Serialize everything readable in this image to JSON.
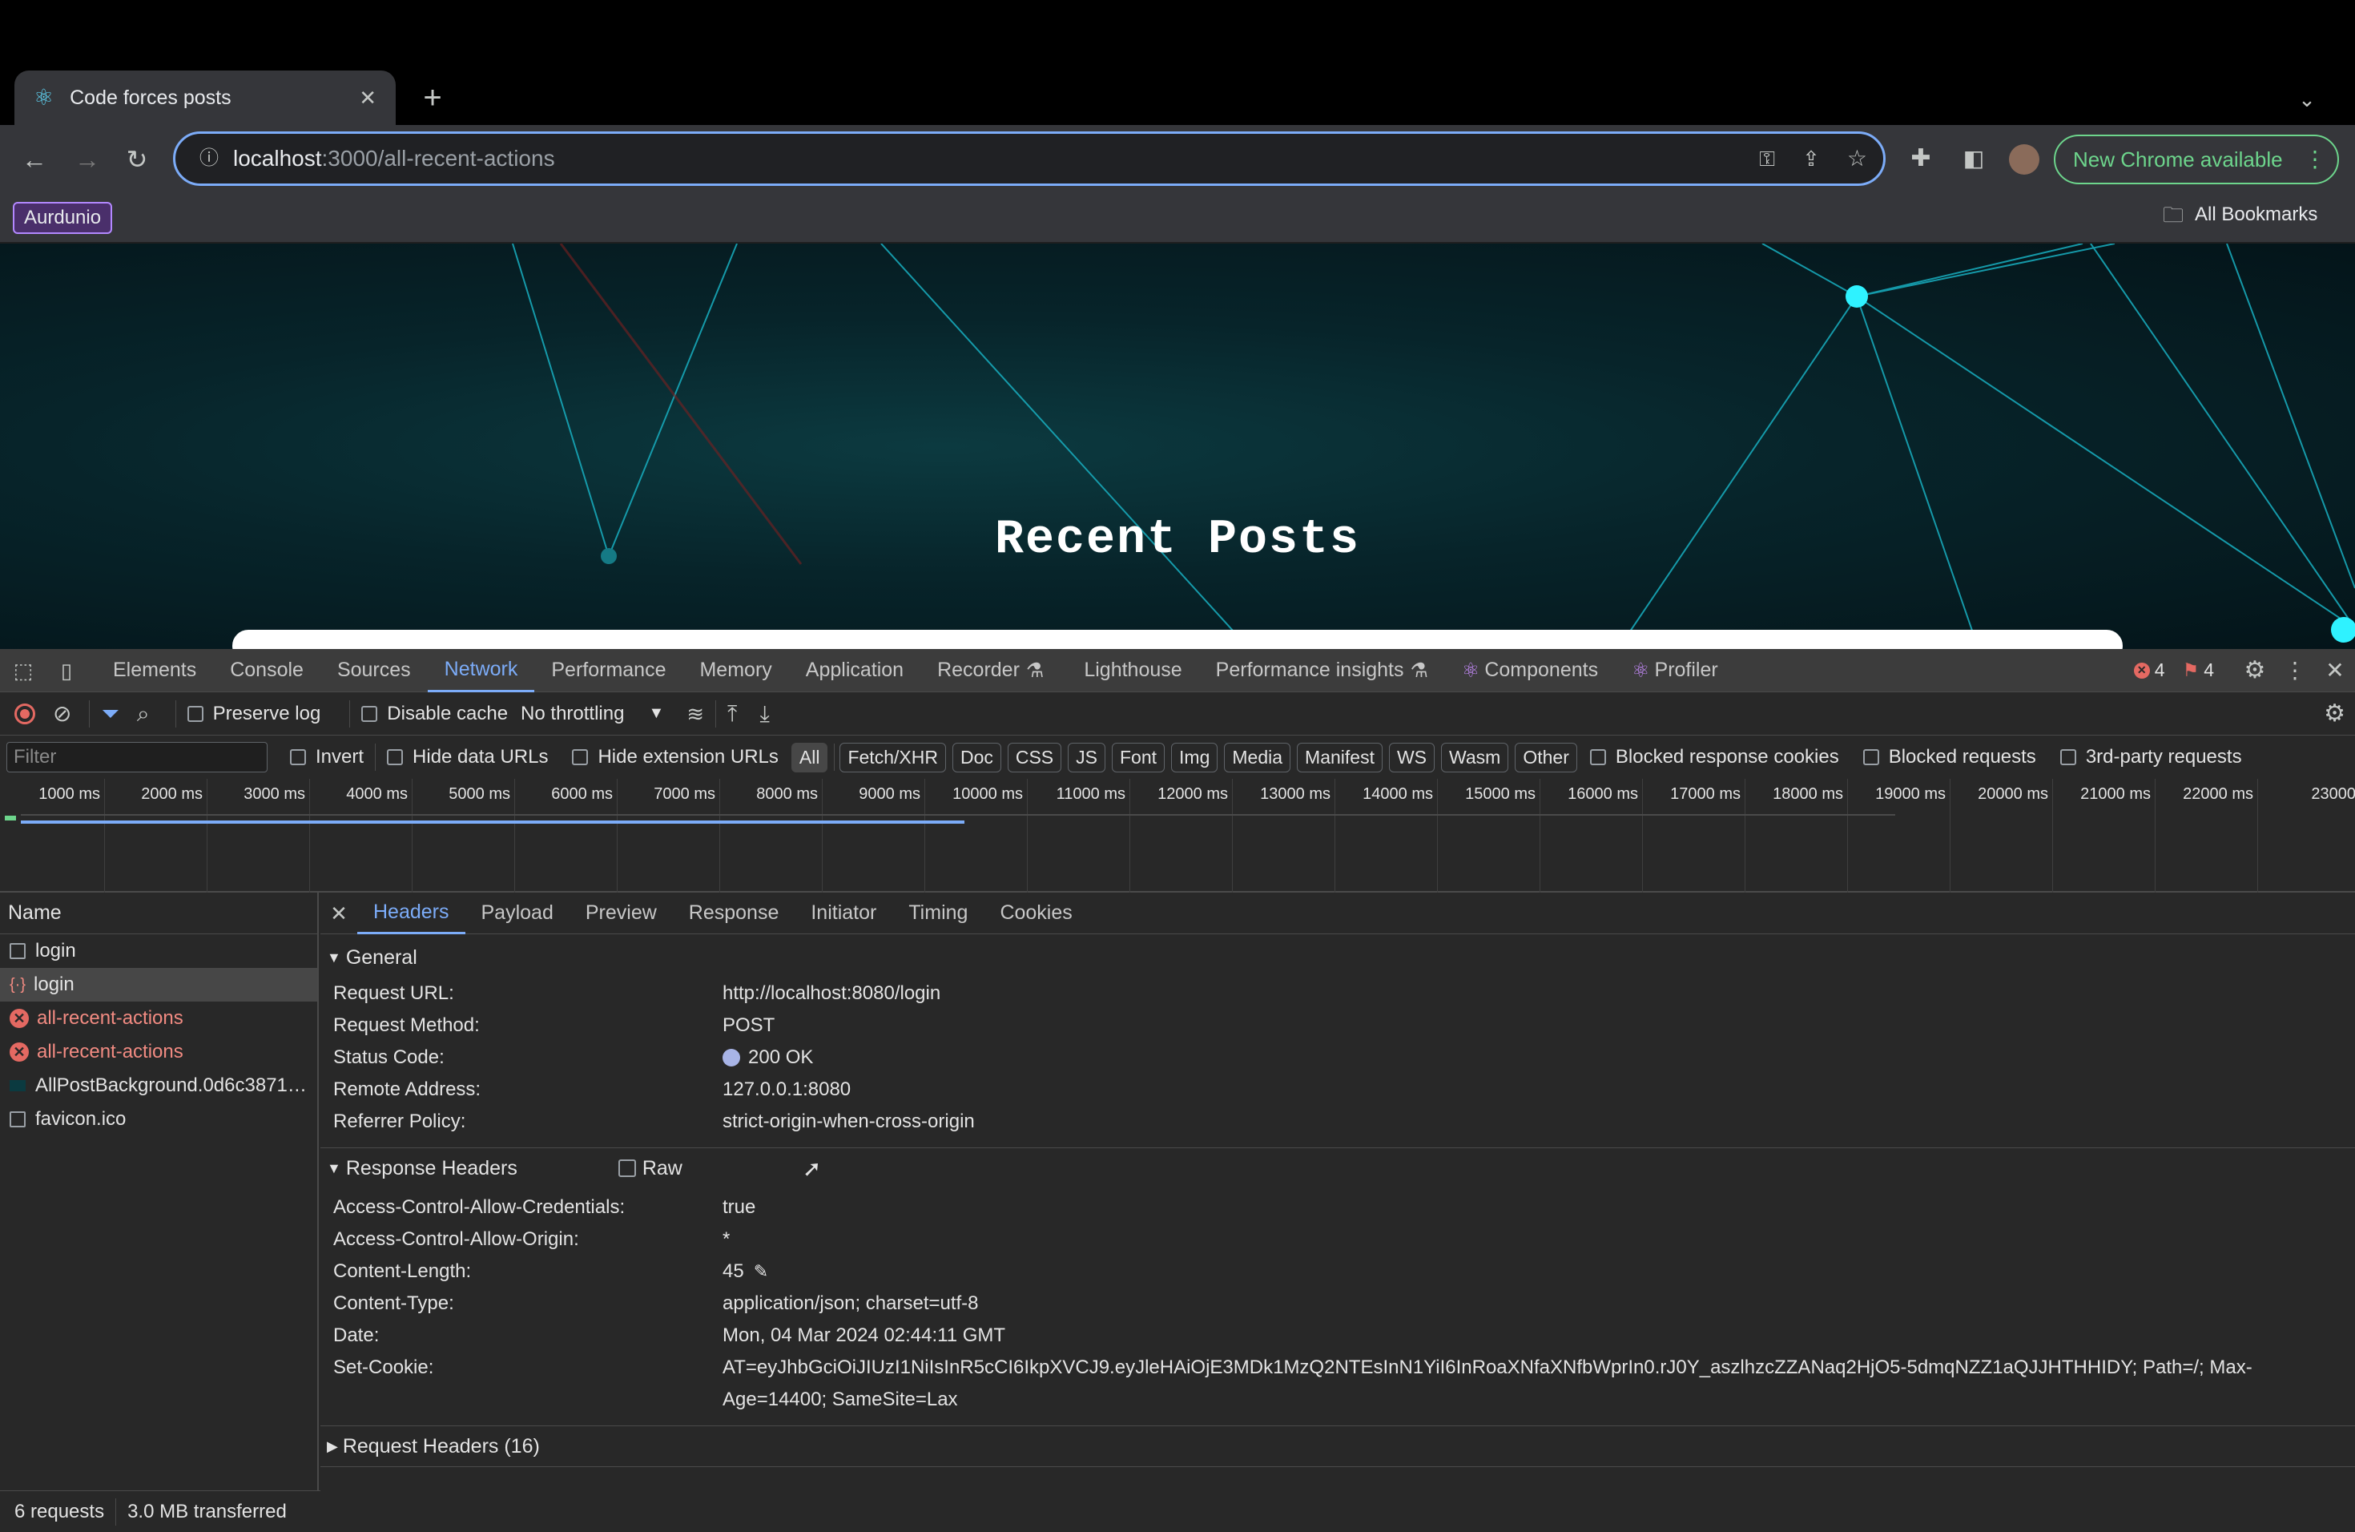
{
  "browser": {
    "tab_title": "Code forces posts",
    "url_host": "localhost",
    "url_path": ":3000/all-recent-actions",
    "new_chrome_label": "New Chrome available",
    "bookmark_folder": "Aurdunio",
    "all_bookmarks": "All Bookmarks"
  },
  "page": {
    "heading": "Recent Posts"
  },
  "devtools": {
    "tabs": [
      "Elements",
      "Console",
      "Sources",
      "Network",
      "Performance",
      "Memory",
      "Application",
      "Recorder",
      "Lighthouse",
      "Performance insights",
      "Components",
      "Profiler"
    ],
    "active_tab": "Network",
    "error_count": "4",
    "warning_count": "4",
    "toolbar": {
      "preserve_log": "Preserve log",
      "disable_cache": "Disable cache",
      "throttling": "No throttling"
    },
    "filter": {
      "placeholder": "Filter",
      "invert": "Invert",
      "hide_data_urls": "Hide data URLs",
      "hide_extension_urls": "Hide extension URLs",
      "types": [
        "All",
        "Fetch/XHR",
        "Doc",
        "CSS",
        "JS",
        "Font",
        "Img",
        "Media",
        "Manifest",
        "WS",
        "Wasm",
        "Other"
      ],
      "blocked_cookies": "Blocked response cookies",
      "blocked_requests": "Blocked requests",
      "third_party": "3rd-party requests"
    },
    "timeline_ticks": [
      "1000 ms",
      "2000 ms",
      "3000 ms",
      "4000 ms",
      "5000 ms",
      "6000 ms",
      "7000 ms",
      "8000 ms",
      "9000 ms",
      "10000 ms",
      "11000 ms",
      "12000 ms",
      "13000 ms",
      "14000 ms",
      "15000 ms",
      "16000 ms",
      "17000 ms",
      "18000 ms",
      "19000 ms",
      "20000 ms",
      "21000 ms",
      "22000 ms",
      "23000"
    ],
    "name_header": "Name",
    "requests": [
      {
        "name": "login",
        "state": "normal"
      },
      {
        "name": "login",
        "state": "selected"
      },
      {
        "name": "all-recent-actions",
        "state": "error"
      },
      {
        "name": "all-recent-actions",
        "state": "error"
      },
      {
        "name": "AllPostBackground.0d6c3871…",
        "state": "image"
      },
      {
        "name": "favicon.ico",
        "state": "normal"
      }
    ],
    "status_requests": "6 requests",
    "status_transferred": "3.0 MB transferred",
    "detail_tabs": [
      "Headers",
      "Payload",
      "Preview",
      "Response",
      "Initiator",
      "Timing",
      "Cookies"
    ],
    "general_title": "General",
    "general": [
      {
        "k": "Request URL:",
        "v": "http://localhost:8080/login"
      },
      {
        "k": "Request Method:",
        "v": "POST"
      },
      {
        "k": "Status Code:",
        "v": "200 OK"
      },
      {
        "k": "Remote Address:",
        "v": "127.0.0.1:8080"
      },
      {
        "k": "Referrer Policy:",
        "v": "strict-origin-when-cross-origin"
      }
    ],
    "response_title": "Response Headers",
    "raw_label": "Raw",
    "response": [
      {
        "k": "Access-Control-Allow-Credentials:",
        "v": "true"
      },
      {
        "k": "Access-Control-Allow-Origin:",
        "v": "*"
      },
      {
        "k": "Content-Length:",
        "v": "45"
      },
      {
        "k": "Content-Type:",
        "v": "application/json; charset=utf-8"
      },
      {
        "k": "Date:",
        "v": "Mon, 04 Mar 2024 02:44:11 GMT"
      }
    ],
    "set_cookie_key": "Set-Cookie:",
    "set_cookie_line1": "AT=eyJhbGciOiJIUzI1NiIsInR5cCI6IkpXVCJ9.eyJleHAiOjE3MDk1MzQ2NTEsInN1YiI6InRoaXNfaXNfbWprIn0.rJ0Y_aszlhzcZZANaq2HjO5-5dmqNZZ1aQJJHTHHIDY; Path=/; Max-",
    "set_cookie_line2": "Age=14400; SameSite=Lax",
    "request_headers_title": "Request Headers (16)"
  }
}
